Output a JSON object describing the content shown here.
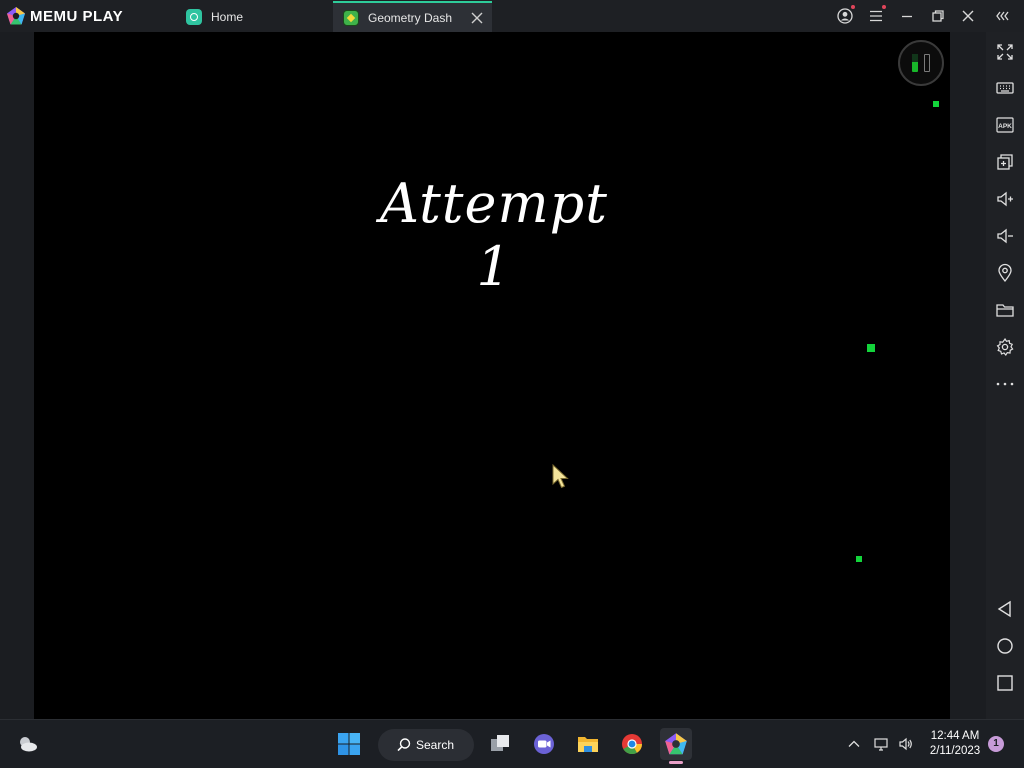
{
  "app": {
    "logo_text": "MEMU PLAY",
    "tabs": [
      {
        "label": "Home",
        "icon": "memu-home-icon"
      },
      {
        "label": "Geometry Dash",
        "icon": "geometry-dash-icon",
        "active": true
      }
    ],
    "colors": {
      "accent": "#2ecc9a",
      "titlebar": "#1e2024",
      "notification_dot": "#e0455a"
    }
  },
  "window_controls": [
    "account-icon",
    "menu-icon",
    "minimize-icon",
    "restore-icon",
    "close-icon",
    "collapse-sidebar-icon"
  ],
  "game": {
    "attempt_text": "Attempt 1",
    "background": "#000000",
    "particle_color": "#13d43b",
    "pause_button": "pause-icon"
  },
  "sidebar": {
    "items": [
      {
        "name": "fullscreen-icon"
      },
      {
        "name": "keyboard-mapping-icon"
      },
      {
        "name": "apk-install-icon"
      },
      {
        "name": "multi-instance-icon"
      },
      {
        "name": "volume-up-icon"
      },
      {
        "name": "volume-down-icon"
      },
      {
        "name": "location-icon"
      },
      {
        "name": "shared-folder-icon"
      },
      {
        "name": "settings-icon"
      },
      {
        "name": "more-icon"
      }
    ],
    "apk_label": "APK",
    "nav": [
      {
        "name": "android-back-icon"
      },
      {
        "name": "android-home-icon"
      },
      {
        "name": "android-recents-icon"
      }
    ]
  },
  "taskbar": {
    "search_label": "Search",
    "apps": [
      "start-icon",
      "task-view-icon",
      "teams-icon",
      "file-explorer-icon",
      "chrome-icon",
      "memu-taskbar-icon"
    ],
    "clock_time": "12:44 AM",
    "clock_date": "2/11/2023",
    "notification_count": "1"
  }
}
